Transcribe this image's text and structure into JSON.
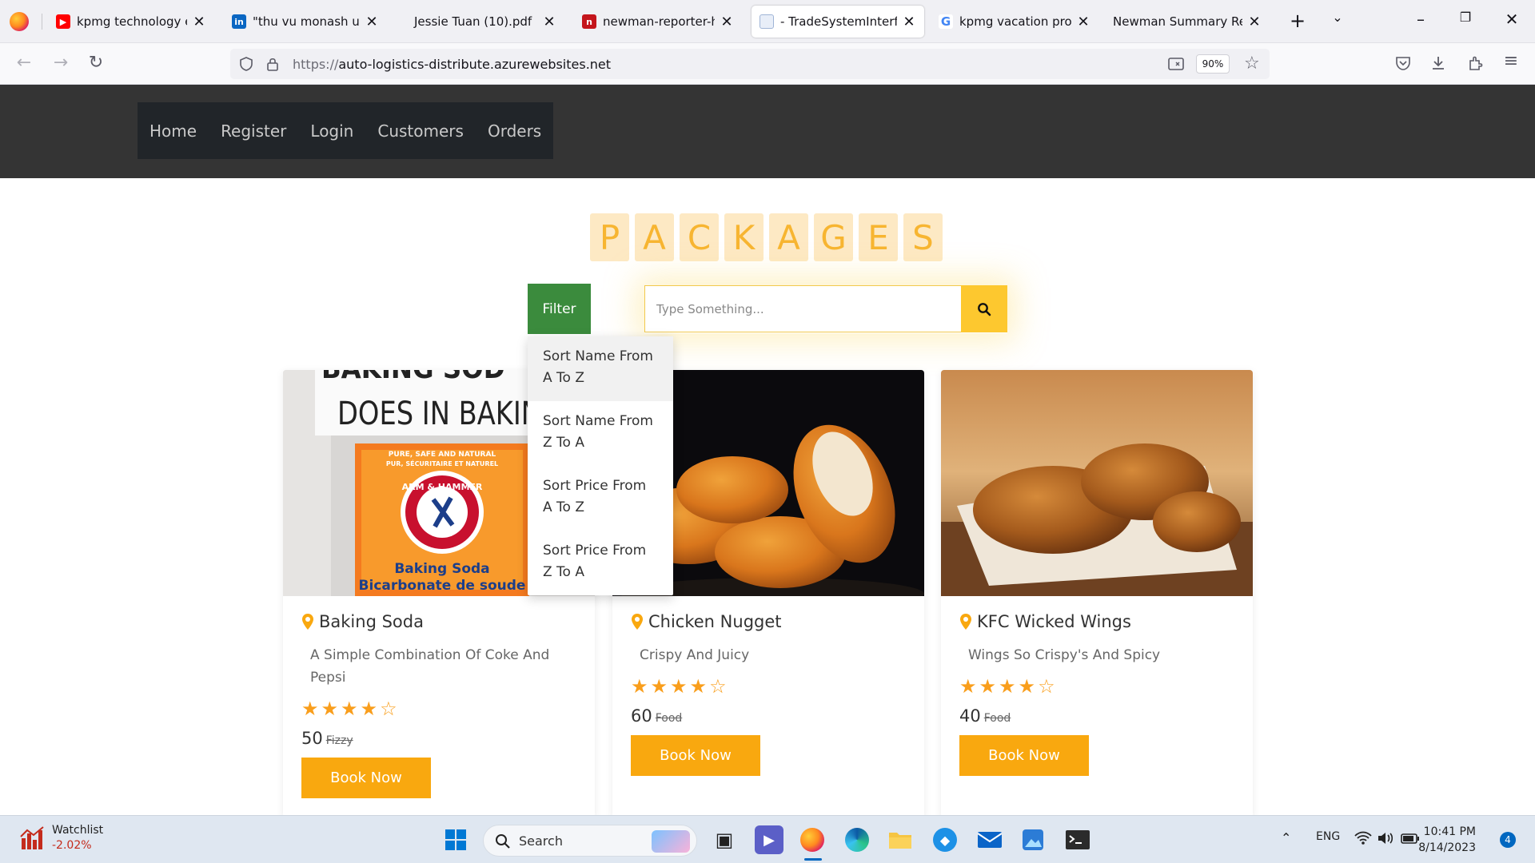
{
  "browser": {
    "tabs": [
      {
        "title": "kpmg technology engi",
        "icon": "youtube-icon",
        "active": false
      },
      {
        "title": "\"thu vu monash univer",
        "icon": "linkedin-icon",
        "active": false
      },
      {
        "title": "Jessie Tuan (10).pdf",
        "icon": "pdf-icon",
        "active": false
      },
      {
        "title": "newman-reporter-htm",
        "icon": "newman-icon",
        "active": false
      },
      {
        "title": "- TradeSystemInterfac",
        "icon": "page-icon",
        "active": true
      },
      {
        "title": "kpmg vacation progra",
        "icon": "google-icon",
        "active": false
      },
      {
        "title": "Newman Summary Report",
        "icon": "none",
        "active": false
      }
    ],
    "url_protocol": "https://",
    "url_host": "auto-logistics-distribute.azurewebsites.net",
    "zoom": "90%"
  },
  "site": {
    "nav": [
      "Home",
      "Register",
      "Login",
      "Customers",
      "Orders"
    ],
    "title_letters": [
      "P",
      "A",
      "C",
      "K",
      "A",
      "G",
      "E",
      "S"
    ],
    "filter_label": "Filter",
    "search_placeholder": "Type Something...",
    "dropdown": [
      "Sort Name From A To Z",
      "Sort Name From Z To A",
      "Sort Price From A To Z",
      "Sort Price From Z To A"
    ],
    "packages": [
      {
        "name": "Baking Soda",
        "description": "A Simple Combination Of Coke And Pepsi",
        "rating": 4,
        "max_rating": 5,
        "price": "50",
        "old_label": "Fizzy",
        "button": "Book Now",
        "image": "baking-soda-photo"
      },
      {
        "name": "Chicken Nugget",
        "description": "Crispy And Juicy",
        "rating": 4,
        "max_rating": 5,
        "price": "60",
        "old_label": "Food",
        "button": "Book Now",
        "image": "chicken-nugget-photo"
      },
      {
        "name": "KFC Wicked Wings",
        "description": "Wings So Crispy's And Spicy",
        "rating": 4,
        "max_rating": 5,
        "price": "40",
        "old_label": "Food",
        "button": "Book Now",
        "image": "fried-wings-photo"
      }
    ],
    "baking_soda_image_text": {
      "headline_top": "BAKING SOD",
      "headline": "DOES IN BAKIN",
      "box_tag1": "PURE, SAFE AND NATURAL",
      "box_tag2": "PUR, SÉCURITAIRE ET NATUREL",
      "brand": "ARM & HAMMER",
      "product": "Baking Soda",
      "product_fr": "Bicarbonate de soude"
    }
  },
  "taskbar": {
    "watchlist_title": "Watchlist",
    "watchlist_value": "-2.02%",
    "search_label": "Search",
    "lang": "ENG",
    "time": "10:41 PM",
    "date": "8/14/2023",
    "badge": "4"
  }
}
